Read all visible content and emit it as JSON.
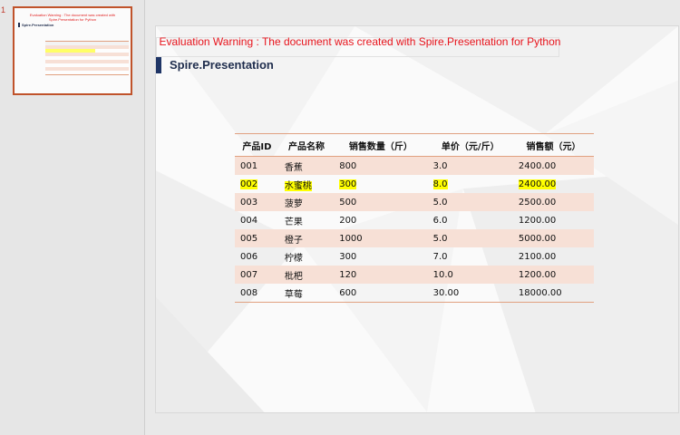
{
  "thumbnail": {
    "number": "1"
  },
  "slide": {
    "warning": "Evaluation Warning : The document was created with Spire.Presentation for Python",
    "title": "Spire.Presentation"
  },
  "table": {
    "headers": [
      "产品ID",
      "产品名称",
      "销售数量（斤）",
      "单价（元/斤）",
      "销售额（元）"
    ],
    "rows": [
      {
        "cells": [
          "001",
          "香蕉",
          "800",
          "3.0",
          "2400.00"
        ],
        "highlight": false
      },
      {
        "cells": [
          "002",
          "水蜜桃",
          "300",
          "8.0",
          "2400.00"
        ],
        "highlight": true
      },
      {
        "cells": [
          "003",
          "菠萝",
          "500",
          "5.0",
          "2500.00"
        ],
        "highlight": false
      },
      {
        "cells": [
          "004",
          "芒果",
          "200",
          "6.0",
          "1200.00"
        ],
        "highlight": false
      },
      {
        "cells": [
          "005",
          "橙子",
          "1000",
          "5.0",
          "5000.00"
        ],
        "highlight": false
      },
      {
        "cells": [
          "006",
          "柠檬",
          "300",
          "7.0",
          "2100.00"
        ],
        "highlight": false
      },
      {
        "cells": [
          "007",
          "枇杷",
          "120",
          "10.0",
          "1200.00"
        ],
        "highlight": false
      },
      {
        "cells": [
          "008",
          "草莓",
          "600",
          "30.00",
          "18000.00"
        ],
        "highlight": false
      }
    ]
  },
  "colors": {
    "warning": "#e8141c",
    "title": "#1f2d4d",
    "row_shade": "#f7e0d6",
    "highlight": "#ffff00",
    "thumb_border": "#c0532b"
  }
}
